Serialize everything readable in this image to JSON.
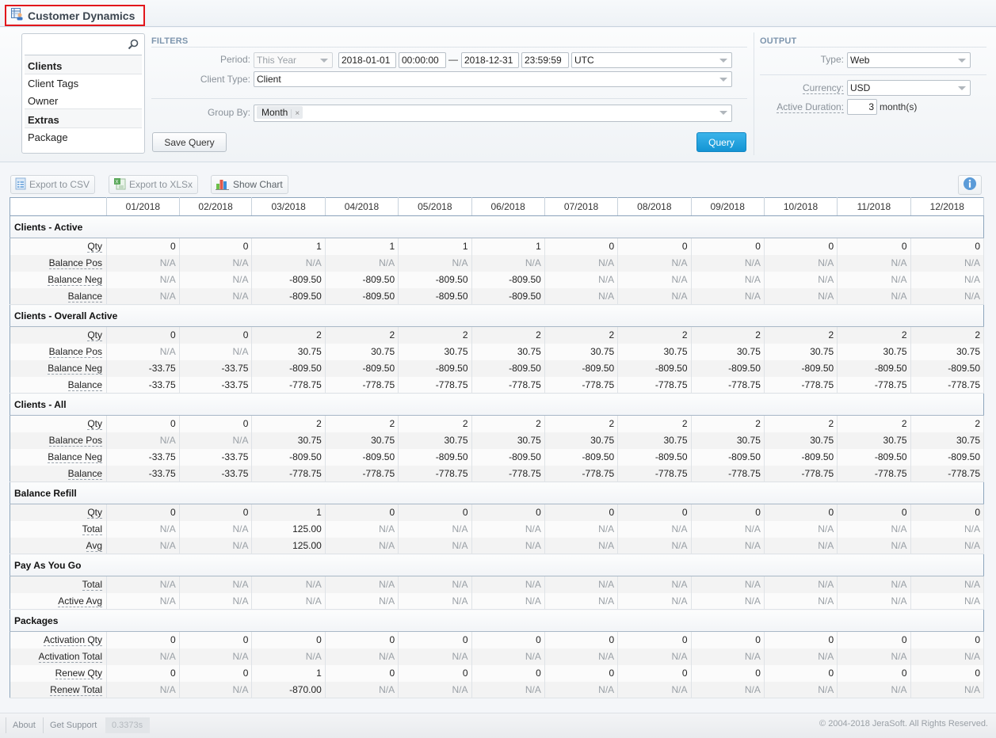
{
  "header": {
    "title": "Customer Dynamics",
    "title_icon": "report-user-icon",
    "accent_color": "#e2161b"
  },
  "sidebar": {
    "search_placeholder": "",
    "groups": [
      {
        "label": "Clients",
        "items": [
          "Client Tags",
          "Owner"
        ]
      },
      {
        "label": "Extras",
        "items": [
          "Package"
        ]
      }
    ]
  },
  "filters": {
    "section_title": "FILTERS",
    "period_label": "Period:",
    "period_value": "This Year",
    "date_from": "2018-01-01",
    "time_from": "00:00:00",
    "range_dash": "—",
    "date_to": "2018-12-31",
    "time_to": "23:59:59",
    "timezone": "UTC",
    "client_type_label": "Client Type:",
    "client_type_value": "Client",
    "group_by_label": "Group By:",
    "group_by_tags": [
      "Month"
    ],
    "group_by_tag_remove": "×",
    "save_query_label": "Save Query",
    "query_label": "Query",
    "query_color": "#1a9ddc"
  },
  "output": {
    "section_title": "OUTPUT",
    "type_label": "Type:",
    "type_value": "Web",
    "currency_label": "Currency:",
    "currency_value": "USD",
    "active_duration_label": "Active Duration:",
    "active_duration_value": "3",
    "active_duration_unit": "month(s)"
  },
  "toolbar": {
    "export_csv_label": "Export to CSV",
    "export_xlsx_label": "Export to XLSx",
    "show_chart_label": "Show Chart",
    "info_icon": "info-icon"
  },
  "table": {
    "columns": [
      "01/2018",
      "02/2018",
      "03/2018",
      "04/2018",
      "05/2018",
      "06/2018",
      "07/2018",
      "08/2018",
      "09/2018",
      "10/2018",
      "11/2018",
      "12/2018"
    ],
    "groups": [
      {
        "label": "Clients - Active",
        "rows": [
          {
            "label": "Qty",
            "values": [
              "0",
              "0",
              "1",
              "1",
              "1",
              "1",
              "0",
              "0",
              "0",
              "0",
              "0",
              "0"
            ]
          },
          {
            "label": "Balance Pos",
            "values": [
              "N/A",
              "N/A",
              "N/A",
              "N/A",
              "N/A",
              "N/A",
              "N/A",
              "N/A",
              "N/A",
              "N/A",
              "N/A",
              "N/A"
            ]
          },
          {
            "label": "Balance Neg",
            "values": [
              "N/A",
              "N/A",
              "-809.50",
              "-809.50",
              "-809.50",
              "-809.50",
              "N/A",
              "N/A",
              "N/A",
              "N/A",
              "N/A",
              "N/A"
            ]
          },
          {
            "label": "Balance",
            "values": [
              "N/A",
              "N/A",
              "-809.50",
              "-809.50",
              "-809.50",
              "-809.50",
              "N/A",
              "N/A",
              "N/A",
              "N/A",
              "N/A",
              "N/A"
            ]
          }
        ]
      },
      {
        "label": "Clients - Overall Active",
        "rows": [
          {
            "label": "Qty",
            "values": [
              "0",
              "0",
              "2",
              "2",
              "2",
              "2",
              "2",
              "2",
              "2",
              "2",
              "2",
              "2"
            ]
          },
          {
            "label": "Balance Pos",
            "values": [
              "N/A",
              "N/A",
              "30.75",
              "30.75",
              "30.75",
              "30.75",
              "30.75",
              "30.75",
              "30.75",
              "30.75",
              "30.75",
              "30.75"
            ]
          },
          {
            "label": "Balance Neg",
            "values": [
              "-33.75",
              "-33.75",
              "-809.50",
              "-809.50",
              "-809.50",
              "-809.50",
              "-809.50",
              "-809.50",
              "-809.50",
              "-809.50",
              "-809.50",
              "-809.50"
            ]
          },
          {
            "label": "Balance",
            "values": [
              "-33.75",
              "-33.75",
              "-778.75",
              "-778.75",
              "-778.75",
              "-778.75",
              "-778.75",
              "-778.75",
              "-778.75",
              "-778.75",
              "-778.75",
              "-778.75"
            ]
          }
        ]
      },
      {
        "label": "Clients - All",
        "rows": [
          {
            "label": "Qty",
            "values": [
              "0",
              "0",
              "2",
              "2",
              "2",
              "2",
              "2",
              "2",
              "2",
              "2",
              "2",
              "2"
            ]
          },
          {
            "label": "Balance Pos",
            "values": [
              "N/A",
              "N/A",
              "30.75",
              "30.75",
              "30.75",
              "30.75",
              "30.75",
              "30.75",
              "30.75",
              "30.75",
              "30.75",
              "30.75"
            ]
          },
          {
            "label": "Balance Neg",
            "values": [
              "-33.75",
              "-33.75",
              "-809.50",
              "-809.50",
              "-809.50",
              "-809.50",
              "-809.50",
              "-809.50",
              "-809.50",
              "-809.50",
              "-809.50",
              "-809.50"
            ]
          },
          {
            "label": "Balance",
            "values": [
              "-33.75",
              "-33.75",
              "-778.75",
              "-778.75",
              "-778.75",
              "-778.75",
              "-778.75",
              "-778.75",
              "-778.75",
              "-778.75",
              "-778.75",
              "-778.75"
            ]
          }
        ]
      },
      {
        "label": "Balance Refill",
        "rows": [
          {
            "label": "Qty",
            "values": [
              "0",
              "0",
              "1",
              "0",
              "0",
              "0",
              "0",
              "0",
              "0",
              "0",
              "0",
              "0"
            ]
          },
          {
            "label": "Total",
            "values": [
              "N/A",
              "N/A",
              "125.00",
              "N/A",
              "N/A",
              "N/A",
              "N/A",
              "N/A",
              "N/A",
              "N/A",
              "N/A",
              "N/A"
            ]
          },
          {
            "label": "Avg",
            "values": [
              "N/A",
              "N/A",
              "125.00",
              "N/A",
              "N/A",
              "N/A",
              "N/A",
              "N/A",
              "N/A",
              "N/A",
              "N/A",
              "N/A"
            ]
          }
        ]
      },
      {
        "label": "Pay As You Go",
        "rows": [
          {
            "label": "Total",
            "values": [
              "N/A",
              "N/A",
              "N/A",
              "N/A",
              "N/A",
              "N/A",
              "N/A",
              "N/A",
              "N/A",
              "N/A",
              "N/A",
              "N/A"
            ]
          },
          {
            "label": "Active Avg",
            "values": [
              "N/A",
              "N/A",
              "N/A",
              "N/A",
              "N/A",
              "N/A",
              "N/A",
              "N/A",
              "N/A",
              "N/A",
              "N/A",
              "N/A"
            ]
          }
        ]
      },
      {
        "label": "Packages",
        "rows": [
          {
            "label": "Activation Qty",
            "values": [
              "0",
              "0",
              "0",
              "0",
              "0",
              "0",
              "0",
              "0",
              "0",
              "0",
              "0",
              "0"
            ]
          },
          {
            "label": "Activation Total",
            "values": [
              "N/A",
              "N/A",
              "N/A",
              "N/A",
              "N/A",
              "N/A",
              "N/A",
              "N/A",
              "N/A",
              "N/A",
              "N/A",
              "N/A"
            ]
          },
          {
            "label": "Renew Qty",
            "values": [
              "0",
              "0",
              "1",
              "0",
              "0",
              "0",
              "0",
              "0",
              "0",
              "0",
              "0",
              "0"
            ]
          },
          {
            "label": "Renew Total",
            "values": [
              "N/A",
              "N/A",
              "-870.00",
              "N/A",
              "N/A",
              "N/A",
              "N/A",
              "N/A",
              "N/A",
              "N/A",
              "N/A",
              "N/A"
            ]
          }
        ]
      }
    ]
  },
  "footer": {
    "about_label": "About",
    "support_label": "Get Support",
    "timer": "0.3373s",
    "copyright": "© 2004-2018 JeraSoft. All Rights Reserved."
  }
}
